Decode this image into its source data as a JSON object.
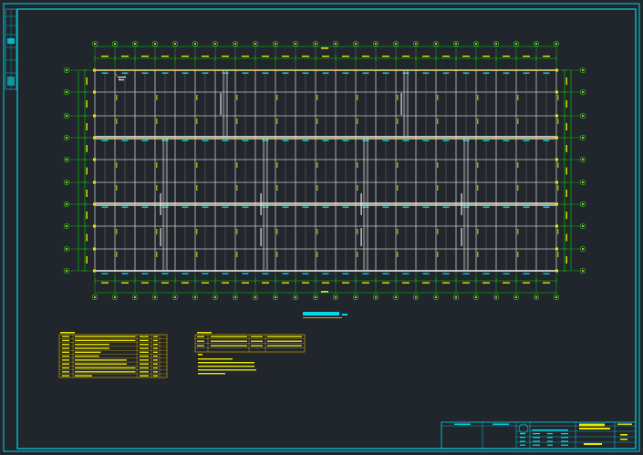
{
  "drawing": {
    "title_bar_label": "",
    "plan_title": "",
    "colors": {
      "background": "#21252c",
      "frame": "#00d8e8",
      "grid_major": "#c8c8c8",
      "grid_minor": "#8c8c8c",
      "axis_line": "#28c828",
      "dimension": "#00d800",
      "beam_highlight": "#f0e070",
      "table_border": "#c8a000",
      "text_yellow": "#e8e800",
      "text_cyan": "#00e0f0"
    },
    "column_axes": [
      "1",
      "2",
      "3",
      "4",
      "5",
      "6",
      "7",
      "8",
      "9",
      "10",
      "11",
      "12",
      "13",
      "14",
      "15",
      "16",
      "17",
      "18",
      "19",
      "20",
      "21",
      "22",
      "23",
      "24"
    ],
    "row_axes": [
      "A",
      "B",
      "C",
      "D",
      "E",
      "F",
      "G",
      "H",
      "J"
    ],
    "bracing_label": "",
    "tables": {
      "left_table_title": "",
      "right_table_title": "",
      "notes_title": ""
    },
    "title_block": {
      "project": "",
      "drawing_name": "",
      "sheet_no": ""
    }
  }
}
